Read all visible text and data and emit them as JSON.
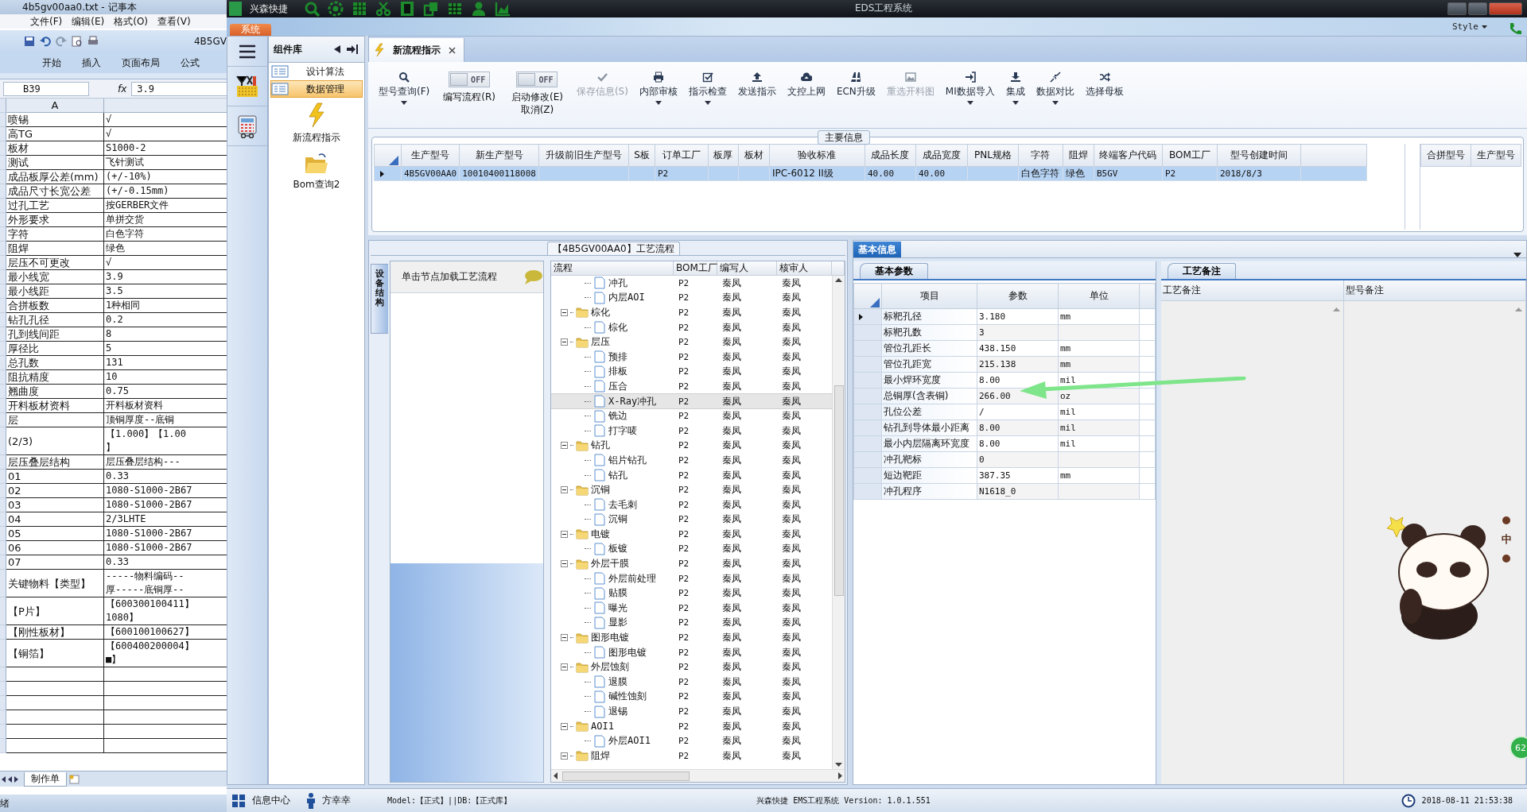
{
  "notepad": {
    "title": "4b5gv00aa0.txt - 记事本",
    "menu": [
      "文件(F)",
      "编辑(E)",
      "格式(O)",
      "查看(V)"
    ]
  },
  "excel": {
    "title": "4B5GV",
    "ribbon_tabs": [
      "开始",
      "插入",
      "页面布局",
      "公式"
    ],
    "name_box": "B39",
    "function_label": "fx",
    "formula": "3.9",
    "column_header": "A",
    "rows": [
      {
        "label": "喷锡",
        "lines": [
          "√"
        ]
      },
      {
        "label": "高TG",
        "lines": [
          "√"
        ]
      },
      {
        "label": "板材",
        "lines": [
          "S1000-2"
        ]
      },
      {
        "label": "测试",
        "lines": [
          "飞针测试"
        ]
      },
      {
        "label": "成品板厚公差(mm)",
        "lines": [
          "(+/-10%)"
        ]
      },
      {
        "label": "成品尺寸长宽公差",
        "lines": [
          "(+/-0.15mm)"
        ]
      },
      {
        "label": "过孔工艺",
        "lines": [
          "按GERBER文件"
        ]
      },
      {
        "label": "外形要求",
        "lines": [
          "单拼交货"
        ]
      },
      {
        "label": "字符",
        "lines": [
          "白色字符"
        ]
      },
      {
        "label": "阻焊",
        "lines": [
          "绿色"
        ]
      },
      {
        "label": "层压不可更改",
        "lines": [
          "√"
        ]
      },
      {
        "label": "最小线宽",
        "lines": [
          "3.9"
        ]
      },
      {
        "label": "最小线距",
        "lines": [
          "3.5"
        ]
      },
      {
        "label": "合拼板数",
        "lines": [
          "1种相同"
        ]
      },
      {
        "label": "钻孔孔径",
        "lines": [
          "0.2"
        ]
      },
      {
        "label": "孔到线间距",
        "lines": [
          "8"
        ]
      },
      {
        "label": "厚径比",
        "lines": [
          "5"
        ]
      },
      {
        "label": "总孔数",
        "lines": [
          "131"
        ]
      },
      {
        "label": "阻抗精度",
        "lines": [
          "10"
        ]
      },
      {
        "label": "翘曲度",
        "lines": [
          "0.75"
        ]
      },
      {
        "label": "开料板材资料",
        "lines": [
          "开料板材资料"
        ]
      },
      {
        "label": "层",
        "lines": [
          "顶铜厚度--底铜"
        ]
      },
      {
        "label": "(2/3)",
        "lines": [
          "【1.000】【1.00",
          "】"
        ]
      },
      {
        "label": "层压叠层结构",
        "lines": [
          "层压叠层结构---"
        ]
      },
      {
        "label": "01",
        "lines": [
          "0.33"
        ]
      },
      {
        "label": "02",
        "lines": [
          "1080-S1000-2B67"
        ]
      },
      {
        "label": "03",
        "lines": [
          "1080-S1000-2B67"
        ]
      },
      {
        "label": "04",
        "lines": [
          "2/3LHTE"
        ]
      },
      {
        "label": "05",
        "lines": [
          "1080-S1000-2B67"
        ]
      },
      {
        "label": "06",
        "lines": [
          "1080-S1000-2B67"
        ]
      },
      {
        "label": "07",
        "lines": [
          "0.33"
        ]
      },
      {
        "label": "关键物料【类型】",
        "lines": [
          "-----物料编码--",
          "厚-----底铜厚--"
        ]
      },
      {
        "label": "【P片】",
        "lines": [
          "【600300100411】",
          "1080】"
        ]
      },
      {
        "label": "【刚性板材】",
        "lines": [
          "【600100100627】"
        ]
      },
      {
        "label": "【铜箔】",
        "lines": [
          "【600400200004】",
          "■】"
        ]
      }
    ],
    "sheet_tab": "制作单",
    "status": "绪"
  },
  "app": {
    "name": "兴森快捷",
    "title": "EDS工程系统",
    "system_tab": "系统",
    "style_menu": "Style"
  },
  "nav": {
    "panel_title": "组件库",
    "categories": [
      {
        "label": "设计算法",
        "selected": false
      },
      {
        "label": "数据管理",
        "selected": true
      }
    ],
    "tools": [
      {
        "label": "新流程指示",
        "kind": "bolt"
      },
      {
        "label": "Bom查询2",
        "kind": "folder"
      }
    ]
  },
  "document_tab": {
    "title": "新流程指示"
  },
  "ribbon": [
    {
      "kind": "button",
      "label": "型号查询(F)",
      "dropdown": true,
      "disabled": false
    },
    {
      "kind": "toggle",
      "label": "编写流程(R)",
      "toggle_text": "OFF",
      "on": false
    },
    {
      "kind": "toggle",
      "label": "启动修改(E)",
      "sublabel": "取消(Z)",
      "toggle_text": "OFF",
      "on": false
    },
    {
      "kind": "button",
      "label": "保存信息(S)",
      "dropdown": false,
      "disabled": true
    },
    {
      "kind": "button",
      "label": "内部审核",
      "dropdown": true,
      "disabled": false
    },
    {
      "kind": "button",
      "label": "指示检查",
      "dropdown": true,
      "disabled": false
    },
    {
      "kind": "button",
      "label": "发送指示",
      "dropdown": false,
      "disabled": false
    },
    {
      "kind": "button",
      "label": "文控上网",
      "dropdown": false,
      "disabled": false
    },
    {
      "kind": "button",
      "label": "ECN升级",
      "dropdown": false,
      "disabled": false
    },
    {
      "kind": "button",
      "label": "重选开料图",
      "dropdown": false,
      "disabled": true
    },
    {
      "kind": "button",
      "label": "MI数据导入",
      "dropdown": true,
      "disabled": false
    },
    {
      "kind": "button",
      "label": "集成",
      "dropdown": true,
      "disabled": false
    },
    {
      "kind": "button",
      "label": "数据对比",
      "dropdown": true,
      "disabled": false
    },
    {
      "kind": "button",
      "label": "选择母板",
      "dropdown": false,
      "disabled": false
    }
  ],
  "main_info": {
    "title": "主要信息",
    "columns": [
      "生产型号",
      "新生产型号",
      "升级前旧生产型号",
      "S板",
      "订单工厂",
      "板厚",
      "板材",
      "验收标准",
      "成品长度",
      "成品宽度",
      "PNL规格",
      "字符",
      "阻焊",
      "终端客户代码",
      "BOM工厂",
      "型号创建时间"
    ],
    "rows": [
      {
        "selected": true,
        "cells": [
          "4B5GV00AA0",
          "10010400118008",
          null,
          null,
          "P2",
          null,
          null,
          "IPC-6012 II级",
          "40.00",
          "40.00",
          null,
          "白色字符",
          "绿色",
          "B5GV",
          "P2",
          "2018/8/3"
        ]
      }
    ],
    "merge_columns": [
      "合拼型号",
      "生产型号"
    ]
  },
  "process": {
    "title": "【4B5GV00AA0】工艺流程",
    "side_tab": "设备结构",
    "hint": "单击节点加载工艺流程",
    "columns": [
      "流程",
      "BOM工厂",
      "编写人",
      "核审人"
    ],
    "tree": [
      {
        "kind": "file",
        "name": "冲孔",
        "bom_factory": "P2",
        "writer": "秦凤",
        "reviewer": "秦凤",
        "selected": false
      },
      {
        "kind": "file",
        "name": "内层AOI",
        "bom_factory": "P2",
        "writer": "秦凤",
        "reviewer": "秦凤",
        "selected": false
      },
      {
        "kind": "folder",
        "name": "棕化",
        "bom_factory": "P2",
        "writer": "秦凤",
        "reviewer": "秦凤",
        "selected": false,
        "expanded": true,
        "children": [
          {
            "kind": "file",
            "name": "棕化",
            "bom_factory": "P2",
            "writer": "秦凤",
            "reviewer": "秦凤",
            "selected": false
          }
        ]
      },
      {
        "kind": "folder",
        "name": "层压",
        "bom_factory": "P2",
        "writer": "秦凤",
        "reviewer": "秦凤",
        "selected": false,
        "expanded": true,
        "children": [
          {
            "kind": "file",
            "name": "预排",
            "bom_factory": "P2",
            "writer": "秦凤",
            "reviewer": "秦凤",
            "selected": false
          },
          {
            "kind": "file",
            "name": "排板",
            "bom_factory": "P2",
            "writer": "秦凤",
            "reviewer": "秦凤",
            "selected": false
          },
          {
            "kind": "file",
            "name": "压合",
            "bom_factory": "P2",
            "writer": "秦凤",
            "reviewer": "秦凤",
            "selected": false
          },
          {
            "kind": "file",
            "name": "X-Ray冲孔",
            "bom_factory": "P2",
            "writer": "秦凤",
            "reviewer": "秦凤",
            "selected": true
          },
          {
            "kind": "file",
            "name": "铣边",
            "bom_factory": "P2",
            "writer": "秦凤",
            "reviewer": "秦凤",
            "selected": false
          },
          {
            "kind": "file",
            "name": "打字唛",
            "bom_factory": "P2",
            "writer": "秦凤",
            "reviewer": "秦凤",
            "selected": false
          }
        ]
      },
      {
        "kind": "folder",
        "name": "钻孔",
        "bom_factory": "P2",
        "writer": "秦凤",
        "reviewer": "秦凤",
        "selected": false,
        "expanded": true,
        "children": [
          {
            "kind": "file",
            "name": "铝片钻孔",
            "bom_factory": "P2",
            "writer": "秦凤",
            "reviewer": "秦凤",
            "selected": false
          },
          {
            "kind": "file",
            "name": "钻孔",
            "bom_factory": "P2",
            "writer": "秦凤",
            "reviewer": "秦凤",
            "selected": false
          }
        ]
      },
      {
        "kind": "folder",
        "name": "沉铜",
        "bom_factory": "P2",
        "writer": "秦凤",
        "reviewer": "秦凤",
        "selected": false,
        "expanded": true,
        "children": [
          {
            "kind": "file",
            "name": "去毛刺",
            "bom_factory": "P2",
            "writer": "秦凤",
            "reviewer": "秦凤",
            "selected": false
          },
          {
            "kind": "file",
            "name": "沉铜",
            "bom_factory": "P2",
            "writer": "秦凤",
            "reviewer": "秦凤",
            "selected": false
          }
        ]
      },
      {
        "kind": "folder",
        "name": "电镀",
        "bom_factory": "P2",
        "writer": "秦凤",
        "reviewer": "秦凤",
        "selected": false,
        "expanded": true,
        "children": [
          {
            "kind": "file",
            "name": "板镀",
            "bom_factory": "P2",
            "writer": "秦凤",
            "reviewer": "秦凤",
            "selected": false
          }
        ]
      },
      {
        "kind": "folder",
        "name": "外层干膜",
        "bom_factory": "P2",
        "writer": "秦凤",
        "reviewer": "秦凤",
        "selected": false,
        "expanded": true,
        "children": [
          {
            "kind": "file",
            "name": "外层前处理",
            "bom_factory": "P2",
            "writer": "秦凤",
            "reviewer": "秦凤",
            "selected": false
          },
          {
            "kind": "file",
            "name": "贴膜",
            "bom_factory": "P2",
            "writer": "秦凤",
            "reviewer": "秦凤",
            "selected": false
          },
          {
            "kind": "file",
            "name": "曝光",
            "bom_factory": "P2",
            "writer": "秦凤",
            "reviewer": "秦凤",
            "selected": false
          },
          {
            "kind": "file",
            "name": "显影",
            "bom_factory": "P2",
            "writer": "秦凤",
            "reviewer": "秦凤",
            "selected": false
          }
        ]
      },
      {
        "kind": "folder",
        "name": "图形电镀",
        "bom_factory": "P2",
        "writer": "秦凤",
        "reviewer": "秦凤",
        "selected": false,
        "expanded": true,
        "children": [
          {
            "kind": "file",
            "name": "图形电镀",
            "bom_factory": "P2",
            "writer": "秦凤",
            "reviewer": "秦凤",
            "selected": false
          }
        ]
      },
      {
        "kind": "folder",
        "name": "外层蚀刻",
        "bom_factory": "P2",
        "writer": "秦凤",
        "reviewer": "秦凤",
        "selected": false,
        "expanded": true,
        "children": [
          {
            "kind": "file",
            "name": "退膜",
            "bom_factory": "P2",
            "writer": "秦凤",
            "reviewer": "秦凤",
            "selected": false
          },
          {
            "kind": "file",
            "name": "碱性蚀刻",
            "bom_factory": "P2",
            "writer": "秦凤",
            "reviewer": "秦凤",
            "selected": false
          },
          {
            "kind": "file",
            "name": "退锡",
            "bom_factory": "P2",
            "writer": "秦凤",
            "reviewer": "秦凤",
            "selected": false
          }
        ]
      },
      {
        "kind": "folder",
        "name": "AOI1",
        "bom_factory": "P2",
        "writer": "秦凤",
        "reviewer": "秦凤",
        "selected": false,
        "expanded": true,
        "children": [
          {
            "kind": "file",
            "name": "外层AOI1",
            "bom_factory": "P2",
            "writer": "秦凤",
            "reviewer": "秦凤",
            "selected": false
          }
        ]
      },
      {
        "kind": "folder",
        "name": "阻焊",
        "bom_factory": "P2",
        "writer": "秦凤",
        "reviewer": "秦凤",
        "selected": false,
        "expanded": true
      }
    ]
  },
  "basic_info": {
    "tab": "基本信息",
    "params_tab": "基本参数",
    "columns": [
      "项目",
      "参数",
      "单位"
    ],
    "rows": [
      {
        "item": "标靶孔径",
        "value": "3.180",
        "unit": "mm",
        "selected": true
      },
      {
        "item": "标靶孔数",
        "value": "3",
        "unit": null,
        "selected": false
      },
      {
        "item": "管位孔距长",
        "value": "438.150",
        "unit": "mm",
        "selected": false
      },
      {
        "item": "管位孔距宽",
        "value": "215.138",
        "unit": "mm",
        "selected": false
      },
      {
        "item": "最小焊环宽度",
        "value": "8.00",
        "unit": "mil",
        "selected": false
      },
      {
        "item": "总铜厚(含表铜)",
        "value": "266.00",
        "unit": "oz",
        "selected": false
      },
      {
        "item": "孔位公差",
        "value": "/",
        "unit": "mil",
        "selected": false
      },
      {
        "item": "钻孔到导体最小距离",
        "value": "8.00",
        "unit": "mil",
        "selected": false
      },
      {
        "item": "最小内层隔离环宽度",
        "value": "8.00",
        "unit": "mil",
        "selected": false
      },
      {
        "item": "冲孔靶标",
        "value": "0",
        "unit": null,
        "selected": false
      },
      {
        "item": "短边靶距",
        "value": "387.35",
        "unit": "mm",
        "selected": false
      },
      {
        "item": "冲孔程序",
        "value": "N1618_0",
        "unit": null,
        "selected": false
      }
    ],
    "remarks_tab": "工艺备注",
    "remarks_columns": [
      "工艺备注",
      "型号备注"
    ]
  },
  "status_bar": {
    "info_center": "信息中心",
    "user": "方幸幸",
    "model": "Model:【正式】||DB:【正式库】",
    "version": "兴森快捷 EMS工程系统 Version: 1.0.1.551",
    "time": "2018-08-11 21:53:38"
  },
  "ime": {
    "label": "中"
  },
  "floating_badge": "62"
}
